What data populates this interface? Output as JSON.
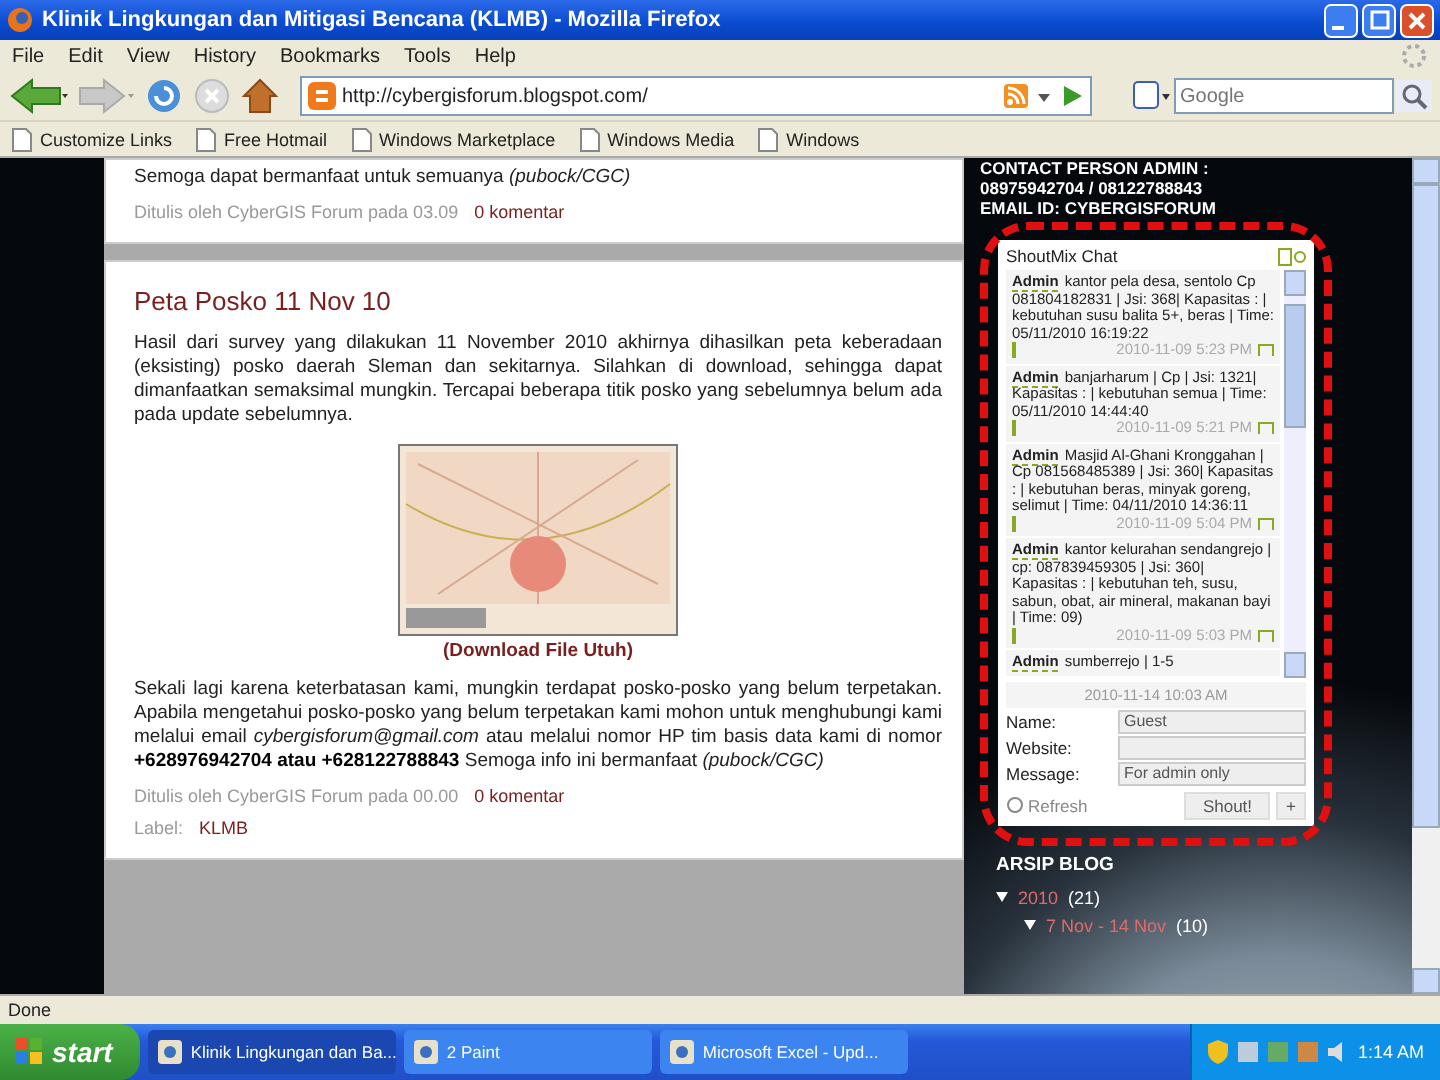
{
  "window": {
    "title": "Klinik Lingkungan dan Mitigasi Bencana (KLMB) - Mozilla Firefox"
  },
  "menu": [
    "File",
    "Edit",
    "View",
    "History",
    "Bookmarks",
    "Tools",
    "Help"
  ],
  "toolbar": {
    "url": "http://cybergisforum.blogspot.com/",
    "search": {
      "placeholder": "Google"
    }
  },
  "bookmarks": [
    "Customize Links",
    "Free Hotmail",
    "Windows Marketplace",
    "Windows Media",
    "Windows"
  ],
  "posts": [
    {
      "blocks": [
        {
          "kind": "paragraph",
          "text": "Semoga dapat bermanfaat untuk semuanya *(pubock/CGC)*"
        },
        {
          "kind": "footer",
          "text": "Ditulis oleh CyberGIS Forum pada 03.09",
          "link": "0 komentar"
        }
      ]
    },
    {
      "blocks": [
        {
          "kind": "title",
          "text": "Peta Posko 11 Nov 10"
        },
        {
          "kind": "paragraph",
          "text": "Hasil dari survey yang dilakukan 11 November 2010 akhirnya dihasilkan peta keberadaan (eksisting) posko daerah Sleman dan sekitarnya. Silahkan di download, sehingga dapat dimanfaatkan semaksimal mungkin. Tercapai beberapa titik posko yang sebelumnya belum ada pada update sebelumnya."
        },
        {
          "kind": "image"
        },
        {
          "kind": "link",
          "text": "(Download File Utuh)"
        },
        {
          "kind": "paragraph",
          "text": "Sekali lagi karena keterbatasan kami, mungkin terdapat posko-posko yang belum terpetakan. Apabila mengetahui posko-posko yang belum terpetakan kami mohon untuk menghubungi kami melalui email *cybergisforum@gmail.com* atau melalui nomor HP tim basis data kami di nomor **+628976942704 atau +628122788843** Semoga info ini bermanfaat *(pubock/CGC)*"
        },
        {
          "kind": "footer",
          "text": "Ditulis oleh CyberGIS Forum pada 00.00",
          "link": "0 komentar"
        },
        {
          "kind": "label",
          "text": "Label:",
          "link": "KLMB"
        }
      ]
    }
  ],
  "sidebar": {
    "contact": [
      "CONTACT PERSON ADMIN :",
      "08975942704 / 08122788843",
      "EMAIL ID: CYBERGISFORUM"
    ],
    "chat": {
      "title": "ShoutMix Chat",
      "messages": [
        {
          "user": "Admin",
          "text": "kantor pela desa, sentolo Cp 081804182831 | Jsi: 368| Kapasitas : | kebutuhan susu balita 5+, beras | Time: 05/11/2010 16:19:22",
          "time": "2010-11-09 5:23 PM"
        },
        {
          "user": "Admin",
          "text": "banjarharum | Cp | Jsi: 1321| Kapasitas : | kebutuhan semua | Time: 05/11/2010 14:44:40",
          "time": "2010-11-09 5:21 PM"
        },
        {
          "user": "Admin",
          "text": "Masjid Al-Ghani Kronggahan | Cp 081568485389 | Jsi: 360| Kapasitas : | kebutuhan beras, minyak goreng, selimut | Time: 04/11/2010 14:36:11",
          "time": "2010-11-09 5:04 PM"
        },
        {
          "user": "Admin",
          "text": "kantor kelurahan sendangrejo | cp: 087839459305 | Jsi: 360| Kapasitas : | kebutuhan teh, susu, sabun, obat, air mineral, makanan bayi | Time: 09)",
          "time": "2010-11-09 5:03 PM"
        },
        {
          "user": "Admin",
          "text": "sumberrejo | 1-5"
        }
      ],
      "date": "2010-11-14 10:03 AM",
      "fields": [
        {
          "label": "Name:",
          "value": "Guest"
        },
        {
          "label": "Website:"
        },
        {
          "label": "Message:",
          "value": "For admin only"
        }
      ],
      "refresh": "Refresh",
      "buttons": [
        "Shout!",
        "+"
      ]
    },
    "archive": {
      "title": "ARSIP BLOG",
      "tree": [
        {
          "label": "2010",
          "count": "(21)",
          "expanded": true,
          "children": [
            {
              "label": "7 Nov - 14 Nov",
              "count": "(10)",
              "expanded": true
            }
          ]
        }
      ]
    }
  },
  "status_bar": "Done",
  "taskbar": {
    "start": "start",
    "tasks": [
      {
        "label": "Klinik Lingkungan dan Ba...",
        "selected": true
      },
      {
        "label": "2 Paint",
        "selected": false
      },
      {
        "label": "Microsoft Excel - Upd...",
        "selected": false
      }
    ],
    "clock": "1:14 AM"
  }
}
